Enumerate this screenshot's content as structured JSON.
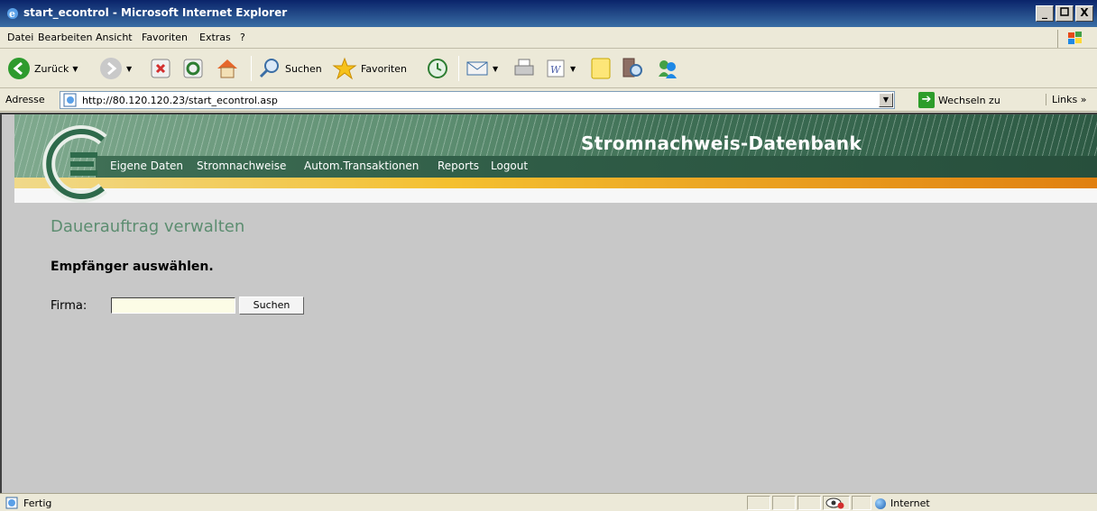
{
  "window": {
    "title": "start_econtrol - Microsoft Internet Explorer",
    "minimize": "_",
    "maximize": " ",
    "close": "X"
  },
  "menu": [
    "Datei",
    "Bearbeiten",
    "Ansicht",
    "Favoriten",
    "Extras",
    "?"
  ],
  "toolbar": {
    "back_label": "Zurück",
    "search_label": "Suchen",
    "favorites_label": "Favoriten"
  },
  "address": {
    "label": "Adresse",
    "url": "http://80.120.120.23/start_econtrol.asp",
    "go_label": "Wechseln zu",
    "links_label": "Links »"
  },
  "banner": {
    "title": "Stromnachweis-Datenbank",
    "nav": [
      "Eigene Daten",
      "Stromnachweise",
      "Autom.Transaktionen",
      "Reports",
      "Logout"
    ]
  },
  "content": {
    "heading": "Dauerauftrag verwalten",
    "subheading": "Empfänger auswählen.",
    "firma_label": "Firma:",
    "firma_value": "",
    "search_button": "Suchen"
  },
  "status": {
    "text": "Fertig",
    "zone": "Internet"
  },
  "colors": {
    "accent_green": "#5c8d70",
    "banner_orange": "#f4c030",
    "viewport_bg": "#c8c8c8"
  }
}
